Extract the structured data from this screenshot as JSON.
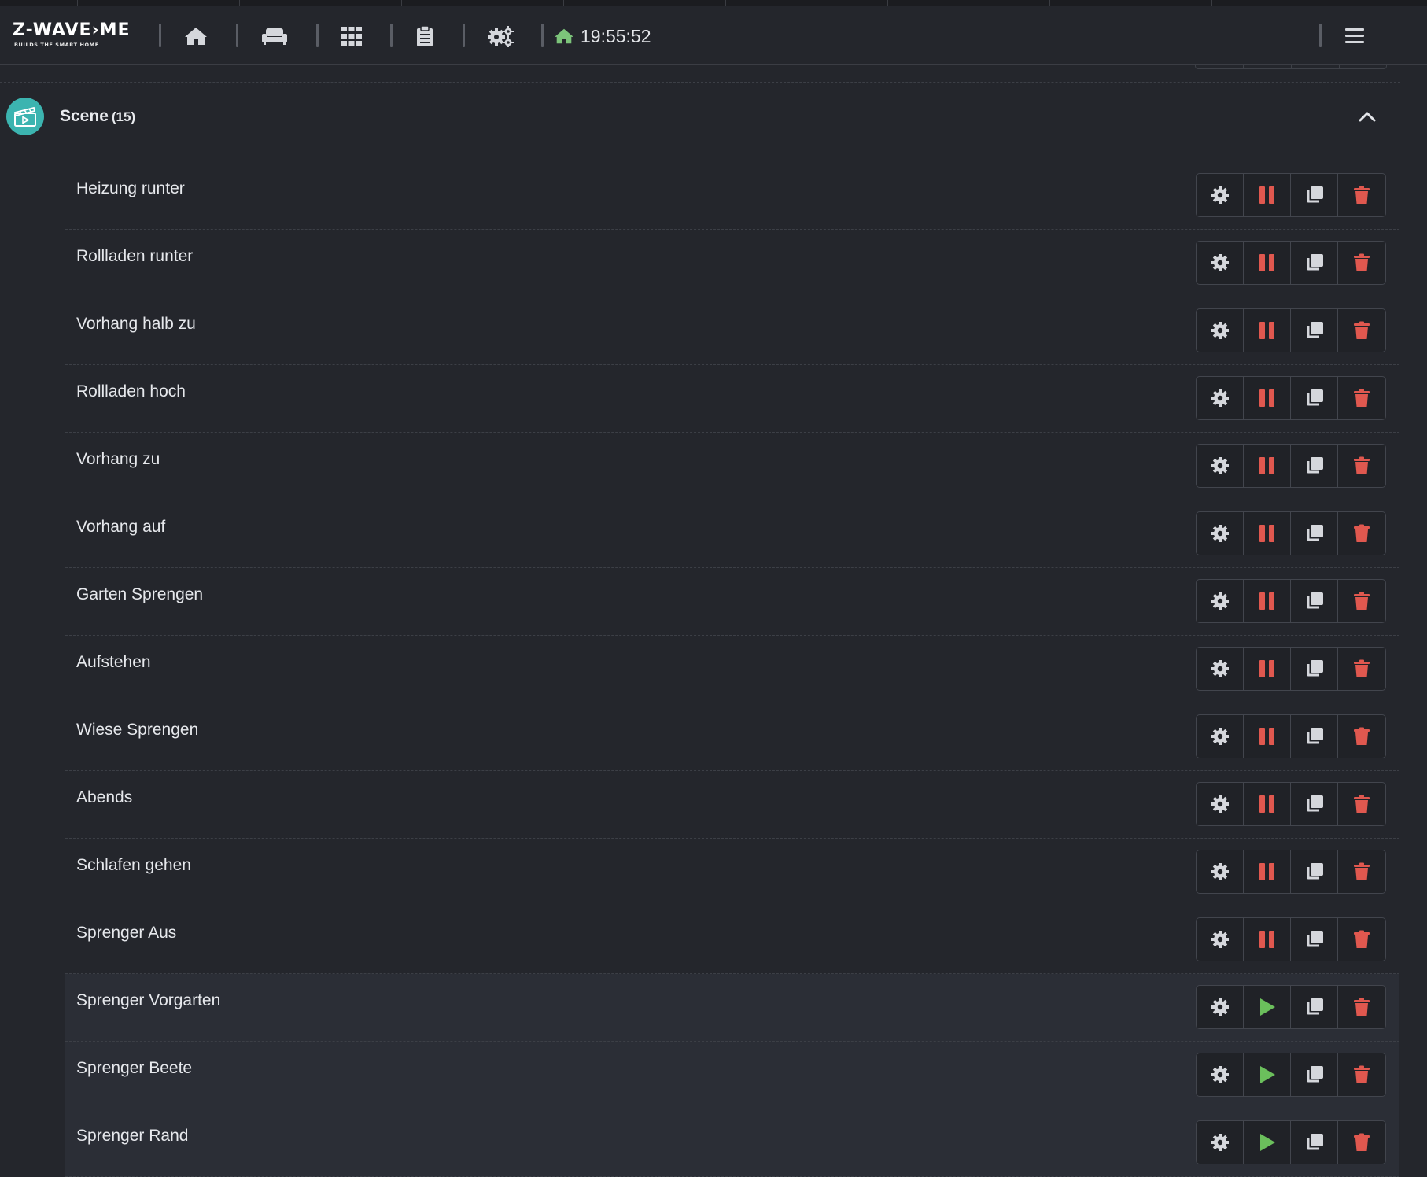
{
  "colors": {
    "background": "#24262c",
    "accent_teal": "#3cb4b0",
    "pause_red": "#e0584f",
    "delete_red": "#e0584f",
    "play_green": "#6bbf5c",
    "status_green": "#7cc47a"
  },
  "navbar": {
    "logo_text": "Z-WAVE›ME",
    "logo_sub": "BUILDS THE SMART HOME",
    "items": [
      {
        "name": "home-icon"
      },
      {
        "name": "rooms-icon"
      },
      {
        "name": "elements-icon"
      },
      {
        "name": "events-icon"
      },
      {
        "name": "settings-icon"
      }
    ],
    "status_icon": "home-icon",
    "time": "19:55:52",
    "menu_icon": "hamburger-icon"
  },
  "section": {
    "icon": "scene-clapperboard-icon",
    "title": "Scene",
    "count": "(15)",
    "collapse_icon": "chevron-up-icon"
  },
  "rows": [
    {
      "label": "Heizung runter",
      "state": "active"
    },
    {
      "label": "Rollladen runter",
      "state": "active"
    },
    {
      "label": "Vorhang halb zu",
      "state": "active"
    },
    {
      "label": "Rollladen hoch",
      "state": "active"
    },
    {
      "label": "Vorhang zu",
      "state": "active"
    },
    {
      "label": "Vorhang auf",
      "state": "active"
    },
    {
      "label": "Garten Sprengen",
      "state": "active"
    },
    {
      "label": "Aufstehen",
      "state": "active"
    },
    {
      "label": "Wiese Sprengen",
      "state": "active"
    },
    {
      "label": "Abends",
      "state": "active"
    },
    {
      "label": "Schlafen gehen",
      "state": "active"
    },
    {
      "label": "Sprenger Aus",
      "state": "active"
    },
    {
      "label": "Sprenger Vorgarten",
      "state": "inactive"
    },
    {
      "label": "Sprenger Beete",
      "state": "inactive"
    },
    {
      "label": "Sprenger Rand",
      "state": "inactive"
    }
  ],
  "row_actions": [
    "gear-icon",
    "pause-icon / play-icon",
    "copy-icon",
    "trash-icon"
  ]
}
